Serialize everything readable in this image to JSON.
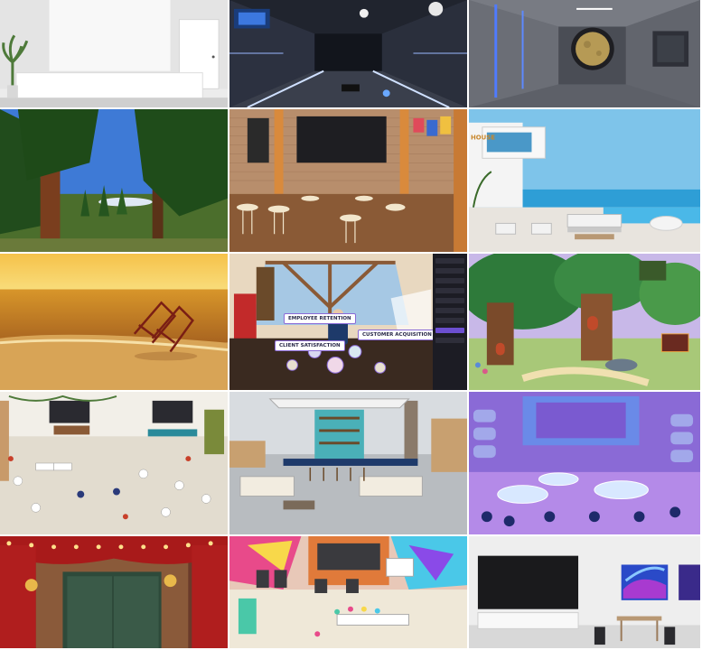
{
  "grid_title": "",
  "tiles": [
    {
      "id": "office-reception",
      "scene": "white reception desk with plant"
    },
    {
      "id": "spaceship-corridor-blue",
      "scene": "sci-fi corridor with blue lights"
    },
    {
      "id": "spaceship-window-moon",
      "scene": "spacecraft interior with moon porthole"
    },
    {
      "id": "redwood-forest",
      "scene": "tall sequoia trees under blue sky"
    },
    {
      "id": "brick-loft-cafe",
      "scene": "loft with TV screen, bar tables and stools"
    },
    {
      "id": "poolside-villa",
      "scene": "modern villa with pool and lounge"
    },
    {
      "id": "golden-beach",
      "scene": "beach chairs at sunset"
    },
    {
      "id": "virtual-event-stage",
      "scene": "presentation hall with floating labels"
    },
    {
      "id": "fairy-tree-house",
      "scene": "cartoon tree houses in forest"
    },
    {
      "id": "open-plan-office",
      "scene": "isometric office with screens and seating"
    },
    {
      "id": "rooftop-bar",
      "scene": "outdoor bar with sofas and city view"
    },
    {
      "id": "neon-ice-lounge",
      "scene": "purple neon lounge with tables"
    },
    {
      "id": "theater-stage",
      "scene": "red curtain theater with string lights"
    },
    {
      "id": "graffiti-studio",
      "scene": "colorful studio with screens and chairs"
    },
    {
      "id": "minimal-gallery",
      "scene": "white room with black screen and art"
    }
  ],
  "event_labels": {
    "employee_retention": "EMPLOYEE RETENTION",
    "customer_acquisition": "CUSTOMER ACQUISITION",
    "client_satisfaction": "CLIENT SATISFACTION"
  },
  "villa_sign": "HOUSE"
}
